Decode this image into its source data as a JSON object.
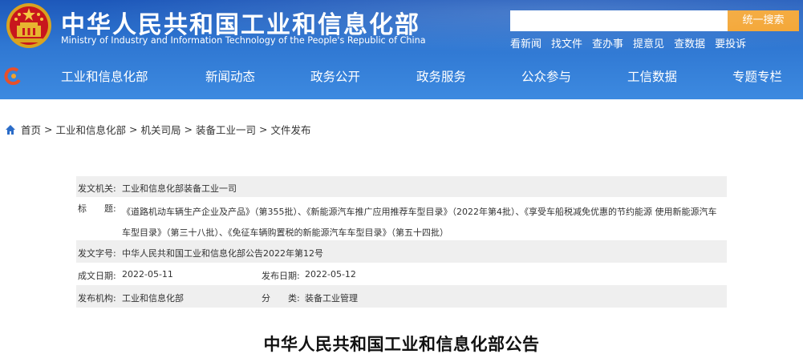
{
  "header": {
    "title_cn": "中华人民共和国工业和信息化部",
    "title_en": "Ministry of Industry and Information Technology of the People's Republic of China",
    "search": {
      "placeholder": "",
      "button_label": "统一搜索"
    },
    "quick_links": [
      "看新闻",
      "找文件",
      "查办事",
      "提意见",
      "查数据",
      "要投诉"
    ]
  },
  "nav": {
    "items": [
      "工业和信息化部",
      "新闻动态",
      "政务公开",
      "政务服务",
      "公众参与",
      "工信数据",
      "专题专栏"
    ]
  },
  "breadcrumb": [
    "首页",
    "工业和信息化部",
    "机关司局",
    "装备工业一司",
    "文件发布"
  ],
  "doc_info": {
    "issuer_label": "发文机关:",
    "issuer": "工业和信息化部装备工业一司",
    "subject_label": "标　　题:",
    "subject": "《道路机动车辆生产企业及产品》（第355批）、《新能源汽车推广应用推荐车型目录》（2022年第4批）、《享受车船税减免优惠的节约能源 使用新能源汽车车型目录》（第三十八批）、《免征车辆购置税的新能源汽车车型目录》（第五十四批）",
    "docno_label": "发文字号:",
    "docno": "中华人民共和国工业和信息化部公告2022年第12号",
    "created_label": "成文日期:",
    "created": "2022-05-11",
    "published_label": "发布日期:",
    "published": "2022-05-12",
    "org_label": "发布机构:",
    "org": "工业和信息化部",
    "category_label": "分　　类:",
    "category": "装备工业管理"
  },
  "document": {
    "title": "中华人民共和国工业和信息化部公告"
  },
  "colors": {
    "header_blue": "#2f77d2",
    "search_button": "#f3a22c",
    "row_gray": "#efefef"
  }
}
